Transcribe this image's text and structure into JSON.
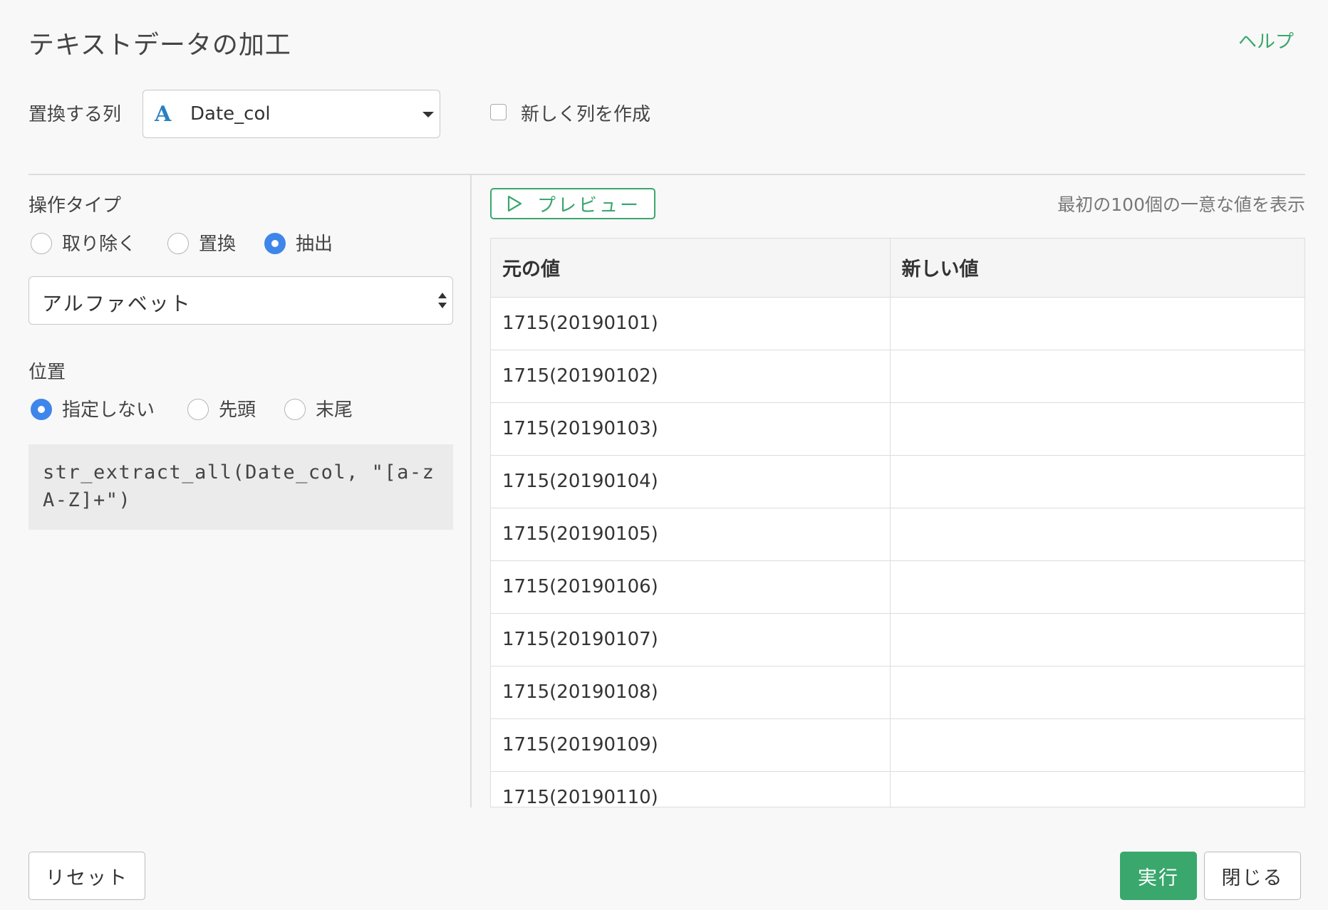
{
  "header": {
    "title": "テキストデータの加工",
    "help": "ヘルプ"
  },
  "column": {
    "label": "置換する列",
    "type_icon": "A",
    "value": "Date_col",
    "new_column_label": "新しく列を作成",
    "new_column_checked": false
  },
  "operation": {
    "label": "操作タイプ",
    "options": [
      "取り除く",
      "置換",
      "抽出"
    ],
    "selected": "抽出",
    "char_type": "アルファベット"
  },
  "position": {
    "label": "位置",
    "options": [
      "指定しない",
      "先頭",
      "末尾"
    ],
    "selected": "指定しない"
  },
  "code": "str_extract_all(Date_col, \"[a-zA-Z]+\")",
  "preview": {
    "button": "プレビュー",
    "note": "最初の100個の一意な値を表示",
    "columns": [
      "元の値",
      "新しい値"
    ],
    "rows": [
      [
        "1715(20190101)",
        ""
      ],
      [
        "1715(20190102)",
        ""
      ],
      [
        "1715(20190103)",
        ""
      ],
      [
        "1715(20190104)",
        ""
      ],
      [
        "1715(20190105)",
        ""
      ],
      [
        "1715(20190106)",
        ""
      ],
      [
        "1715(20190107)",
        ""
      ],
      [
        "1715(20190108)",
        ""
      ],
      [
        "1715(20190109)",
        ""
      ],
      [
        "1715(20190110)",
        ""
      ]
    ]
  },
  "footer": {
    "reset": "リセット",
    "run": "実行",
    "close": "閉じる"
  },
  "colors": {
    "accent_green": "#3aa76d",
    "radio_blue": "#3f86ea",
    "type_icon_blue": "#2a7fc1"
  }
}
